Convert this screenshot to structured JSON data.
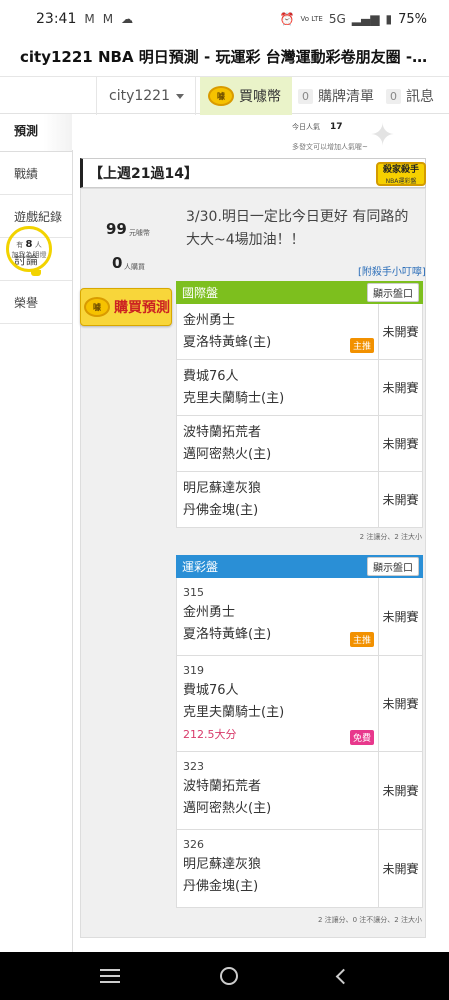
{
  "status_bar": {
    "time": "23:41",
    "icons": [
      "gmail-icon",
      "gmail-icon",
      "cloud-icon",
      "alarm-icon",
      "volte-icon",
      "5g-icon",
      "signal-icon",
      "battery-icon"
    ],
    "network": "5G",
    "battery": "75%"
  },
  "page_title": "city1221 NBA 明日預測 - 玩運彩 台灣運動彩卷朋友圈 - 玩運...",
  "top_nav": {
    "username": "city1221",
    "buy_coins": "買噱幣",
    "cart_count": "0",
    "cart_label": "購牌清單",
    "msg_count": "0",
    "msg_label": "訊息"
  },
  "sidebar": {
    "active": "預測",
    "items": [
      "戰績",
      "遊戲紀錄",
      "討論",
      "榮譽"
    ],
    "bulb_prefix": "有",
    "bulb_count": "8",
    "bulb_unit": "人",
    "bulb_text": "加我為明燈"
  },
  "stats": {
    "today_label": "今日人氣",
    "today_value": "17",
    "hint": "多發文可以增加人氣喔~"
  },
  "record": "【上週21過14】",
  "master_badge": {
    "title": "殺家殺手",
    "sub": "NBA運彩盤"
  },
  "coins": {
    "value": "99",
    "unit": "元噱幣"
  },
  "buyers": {
    "value": "0",
    "unit": "人購買"
  },
  "buy_predict": "購買預測",
  "comment": "3/30.明日一定比今日更好 有同路的大大~4場加油！！",
  "killer_link": "[附殺手小叮嚀]",
  "intl_board": {
    "title": "國際盤",
    "show_btn": "顯示盤口",
    "rows": [
      {
        "away": "金州勇士",
        "home": "夏洛特黃蜂(主)",
        "status": "未開賽",
        "tag": "主推"
      },
      {
        "away": "費城76人",
        "home": "克里夫蘭騎士(主)",
        "status": "未開賽"
      },
      {
        "away": "波特蘭拓荒者",
        "home": "邁阿密熱火(主)",
        "status": "未開賽"
      },
      {
        "away": "明尼蘇達灰狼",
        "home": "丹佛金塊(主)",
        "status": "未開賽"
      }
    ],
    "summary": "2 注讓分、2 注大小"
  },
  "sports_board": {
    "title": "運彩盤",
    "show_btn": "顯示盤口",
    "rows": [
      {
        "num": "315",
        "away": "金州勇士",
        "home": "夏洛特黃蜂(主)",
        "status": "未開賽",
        "tag": "主推"
      },
      {
        "num": "319",
        "away": "費城76人",
        "home": "克里夫蘭騎士(主)",
        "status": "未開賽",
        "extra": "212.5大分",
        "tag": "免費"
      },
      {
        "num": "323",
        "away": "波特蘭拓荒者",
        "home": "邁阿密熱火(主)",
        "status": "未開賽"
      },
      {
        "num": "326",
        "away": "明尼蘇達灰狼",
        "home": "丹佛金塊(主)",
        "status": "未開賽"
      }
    ],
    "summary": "2 注讓分、0 注不讓分、2 注大小"
  },
  "colors": {
    "intl_header": "#7dbf1e",
    "sports_header": "#2a8fd6",
    "tag_main": "#f29100",
    "tag_free": "#e8388c",
    "points": "#d83a6a"
  }
}
